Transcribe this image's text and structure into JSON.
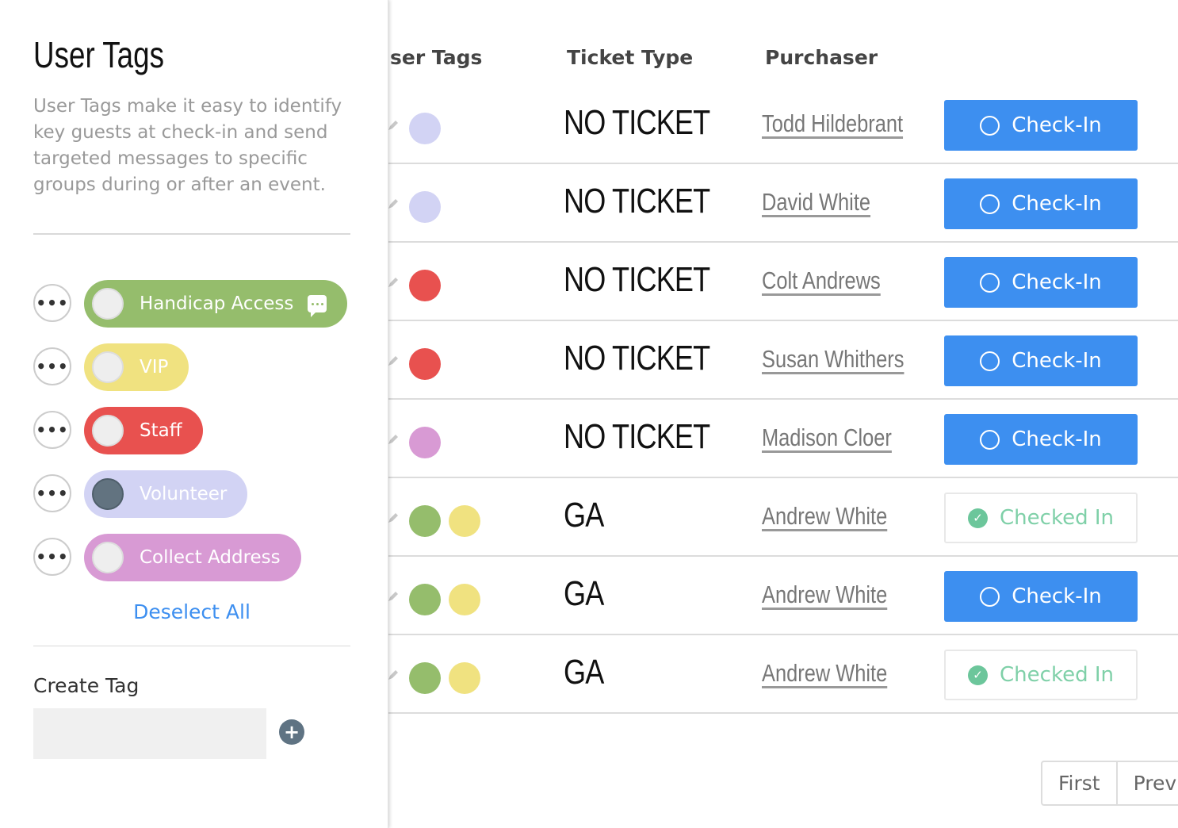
{
  "colors": {
    "lavender": "#d2d3f4",
    "red": "#e8514f",
    "orchid": "#d89ad4",
    "green": "#95bd6c",
    "yellow": "#f0e280",
    "primary_blue": "#3d8ff0",
    "checked_green": "#7fd0a8",
    "volunteer_knob": "#627380"
  },
  "table": {
    "headers": {
      "user_tags": "ser Tags",
      "ticket_type": "Ticket Type",
      "purchaser": "Purchaser"
    },
    "rows": [
      {
        "tags": [
          "lavender"
        ],
        "ticket_type": "NO TICKET",
        "purchaser": "Todd Hildebrant",
        "action": "Check-In",
        "checked_in": false
      },
      {
        "tags": [
          "lavender"
        ],
        "ticket_type": "NO TICKET",
        "purchaser": "David White",
        "action": "Check-In",
        "checked_in": false
      },
      {
        "tags": [
          "red"
        ],
        "ticket_type": "NO TICKET",
        "purchaser": "Colt Andrews",
        "action": "Check-In",
        "checked_in": false
      },
      {
        "tags": [
          "red"
        ],
        "ticket_type": "NO TICKET",
        "purchaser": "Susan Whithers",
        "action": "Check-In",
        "checked_in": false
      },
      {
        "tags": [
          "orchid"
        ],
        "ticket_type": "NO TICKET",
        "purchaser": "Madison Cloer",
        "action": "Check-In",
        "checked_in": false
      },
      {
        "tags": [
          "green",
          "yellow"
        ],
        "ticket_type": "GA",
        "purchaser": "Andrew White",
        "action": "Checked In",
        "checked_in": true
      },
      {
        "tags": [
          "green",
          "yellow"
        ],
        "ticket_type": "GA",
        "purchaser": "Andrew White",
        "action": "Check-In",
        "checked_in": false
      },
      {
        "tags": [
          "green",
          "yellow"
        ],
        "ticket_type": "GA",
        "purchaser": "Andrew White",
        "action": "Checked In",
        "checked_in": true
      }
    ]
  },
  "pagination": {
    "first_label": "First",
    "prev_label": "Previ"
  },
  "panel": {
    "title": "User Tags",
    "description": "User Tags make it easy to identify key guests at check-in and send targeted messages to specific groups during or after an event.",
    "tags": [
      {
        "label": "Handicap Access",
        "color": "#95bd6c",
        "selected": false,
        "has_message_icon": true
      },
      {
        "label": "VIP",
        "color": "#f0e280",
        "selected": false,
        "has_message_icon": false
      },
      {
        "label": "Staff",
        "color": "#e8514f",
        "selected": false,
        "has_message_icon": false
      },
      {
        "label": "Volunteer",
        "color": "#d2d3f4",
        "selected": true,
        "has_message_icon": false
      },
      {
        "label": "Collect Address",
        "color": "#d89ad4",
        "selected": false,
        "has_message_icon": false
      }
    ],
    "more_icon": "ellipsis-icon",
    "deselect_all": "Deselect All",
    "create_tag_label": "Create Tag",
    "create_tag_value": "",
    "add_icon": "plus-icon"
  }
}
